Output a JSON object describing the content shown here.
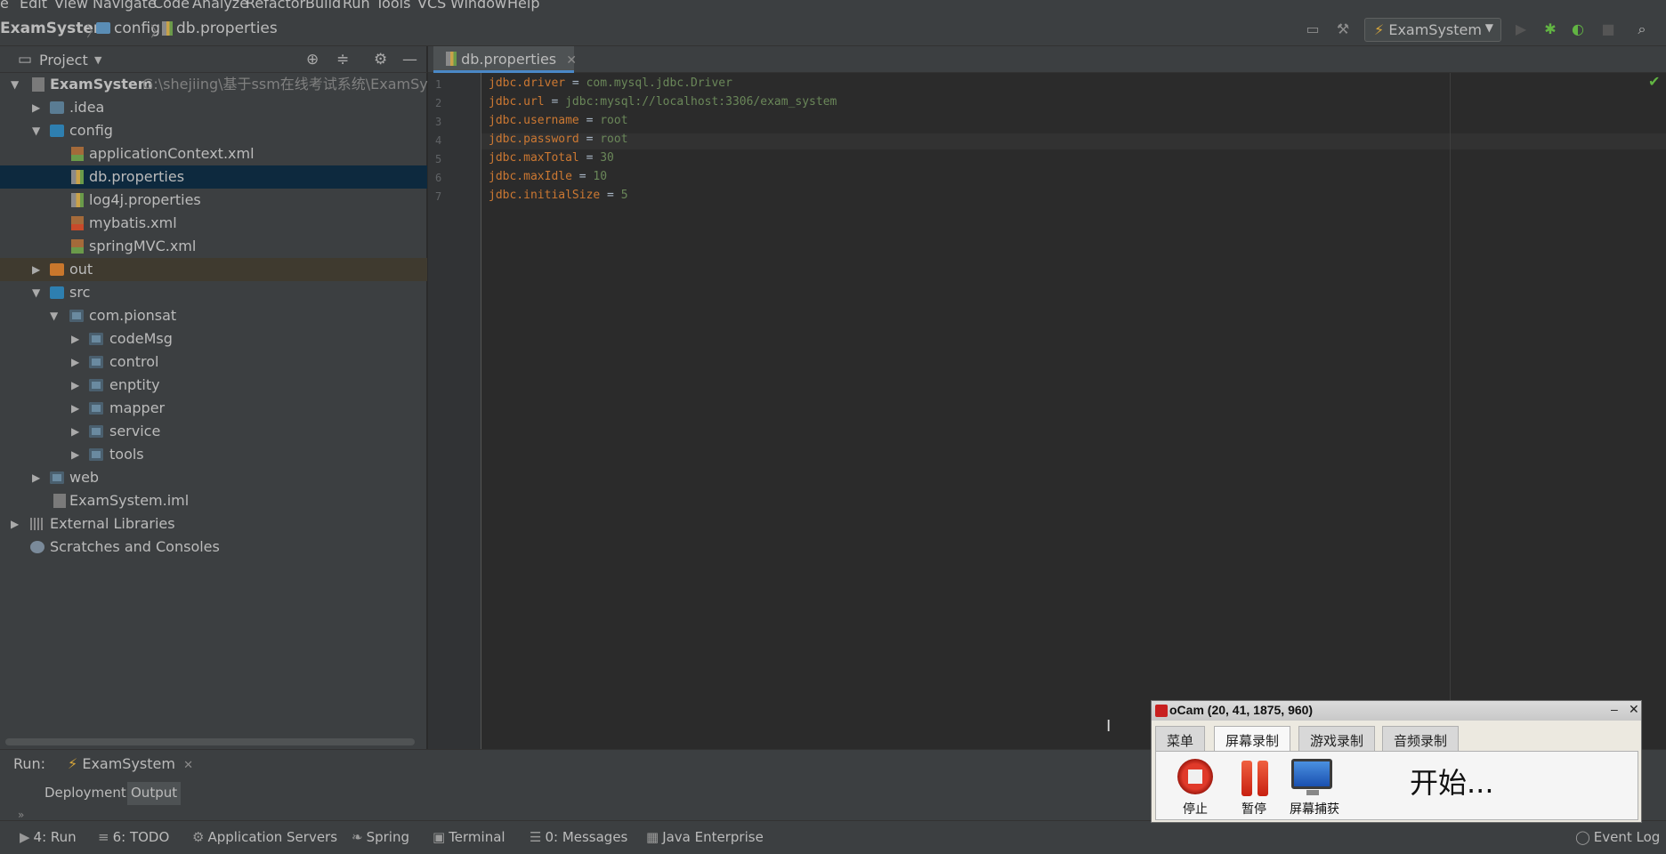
{
  "menu": [
    "e",
    "Edit",
    "View",
    "Navigate",
    "Code",
    "Analyze",
    "Refactor",
    "Build",
    "Run",
    "Tools",
    "VCS",
    "Window",
    "Help"
  ],
  "breadcrumb": {
    "project": "ExamSystem",
    "folder": "config",
    "file": "db.properties"
  },
  "toolbar": {
    "run_config": "ExamSystem"
  },
  "project_panel": {
    "title": "Project",
    "tree": [
      {
        "label": "ExamSystem",
        "path": "G:\\shejiing\\基于ssm在线考试系统\\ExamSyster"
      },
      {
        "label": ".idea"
      },
      {
        "label": "config"
      },
      {
        "label": "applicationContext.xml"
      },
      {
        "label": "db.properties"
      },
      {
        "label": "log4j.properties"
      },
      {
        "label": "mybatis.xml"
      },
      {
        "label": "springMVC.xml"
      },
      {
        "label": "out"
      },
      {
        "label": "src"
      },
      {
        "label": "com.pionsat"
      },
      {
        "label": "codeMsg"
      },
      {
        "label": "control"
      },
      {
        "label": "enptity"
      },
      {
        "label": "mapper"
      },
      {
        "label": "service"
      },
      {
        "label": "tools"
      },
      {
        "label": "web"
      },
      {
        "label": "ExamSystem.iml"
      },
      {
        "label": "External Libraries"
      },
      {
        "label": "Scratches and Consoles"
      }
    ]
  },
  "editor": {
    "tab": "db.properties",
    "line_numbers": [
      "1",
      "2",
      "3",
      "4",
      "5",
      "6",
      "7"
    ],
    "lines": [
      {
        "key": "jdbc.driver",
        "eq": " = ",
        "value": "com.mysql.jdbc.Driver"
      },
      {
        "key": "jdbc.url",
        "eq": " = ",
        "value": "jdbc:mysql://localhost:3306/exam_system"
      },
      {
        "key": "jdbc.username",
        "eq": " = ",
        "value": "root"
      },
      {
        "key": "jdbc.password",
        "eq": " = ",
        "value": "root"
      },
      {
        "key": "jdbc.maxTotal",
        "eq": " = ",
        "value": "30"
      },
      {
        "key": "jdbc.maxIdle",
        "eq": " = ",
        "value": "10"
      },
      {
        "key": "jdbc.initialSize",
        "eq": " = ",
        "value": "5"
      }
    ]
  },
  "run_panel": {
    "label": "Run:",
    "tab": "ExamSystem",
    "subtabs": [
      "Deployment",
      "Output"
    ],
    "divider": "»"
  },
  "statusbar": {
    "items": [
      {
        "glyph": "▶",
        "label": "4: Run"
      },
      {
        "glyph": "≡",
        "label": "6: TODO"
      },
      {
        "glyph": "⚙",
        "label": "Application Servers"
      },
      {
        "glyph": "❧",
        "label": "Spring"
      },
      {
        "glyph": "▣",
        "label": "Terminal"
      },
      {
        "glyph": "☰",
        "label": "0: Messages"
      },
      {
        "glyph": "▦",
        "label": "Java Enterprise"
      }
    ],
    "event_log": "Event Log"
  },
  "ocam": {
    "title": "oCam (20, 41, 1875, 960)",
    "tabs": [
      "菜单",
      "屏幕录制",
      "游戏录制",
      "音频录制"
    ],
    "stop_label": "停止",
    "pause_label": "暂停",
    "capture_label": "屏幕捕获",
    "status": "开始..."
  },
  "colors": {
    "key": "#cc7832",
    "value": "#6a8759",
    "selection": "#0d293e",
    "tab_underline": "#4a88c7"
  }
}
